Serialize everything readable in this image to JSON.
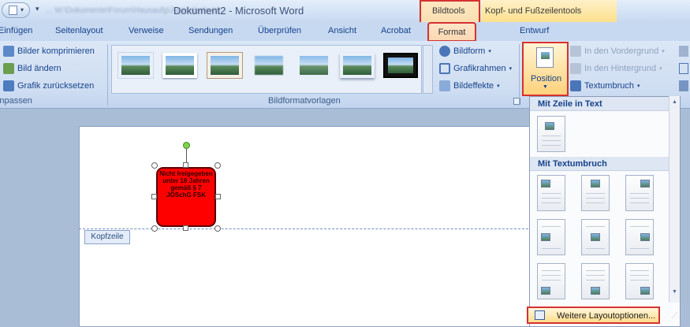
{
  "title_bar": {
    "blurred_path": "... W:\\Dokumente\\Forum\\Hausaufg\\Jugendschutz\\...",
    "doc_title": "Dokument2 - Microsoft Word",
    "bildtools_label": "Bildtools",
    "kopf_fuss_label": "Kopf- und Fußzeilentools"
  },
  "tabs": {
    "einfuegen": "Einfügen",
    "seitenlayout": "Seitenlayout",
    "verweise": "Verweise",
    "sendungen": "Sendungen",
    "ueberpruefen": "Überprüfen",
    "ansicht": "Ansicht",
    "acrobat": "Acrobat",
    "format": "Format",
    "entwurf": "Entwurf"
  },
  "ribbon": {
    "anpassen": {
      "bilder_komprimieren": "Bilder komprimieren",
      "bild_aendern": "Bild ändern",
      "grafik_zuruecksetzen": "Grafik zurücksetzen",
      "group_label": "Anpassen"
    },
    "bildformatvorlagen": {
      "group_label": "Bildformatvorlagen",
      "bildform": "Bildform",
      "grafikrahmen": "Grafikrahmen",
      "bildeffekte": "Bildeffekte"
    },
    "anordnen": {
      "position": "Position",
      "vordergrund": "In den Vordergrund",
      "hintergrund": "In den Hintergrund",
      "textumbruch": "Textumbruch"
    }
  },
  "document": {
    "image_text": "Nicht freigegeben unter 18 Jahren gemäß § 7 JÖSchG FSK",
    "kopfzeile": "Kopfzeile"
  },
  "position_dropdown": {
    "section_inline": "Mit Zeile in Text",
    "section_wrap": "Mit Textumbruch",
    "more_layout_options": "Weitere Layoutoptionen..."
  },
  "colors": {
    "highlight_red": "#d63131",
    "image_red": "#ff0000",
    "ribbon_blue": "#d0def2"
  }
}
